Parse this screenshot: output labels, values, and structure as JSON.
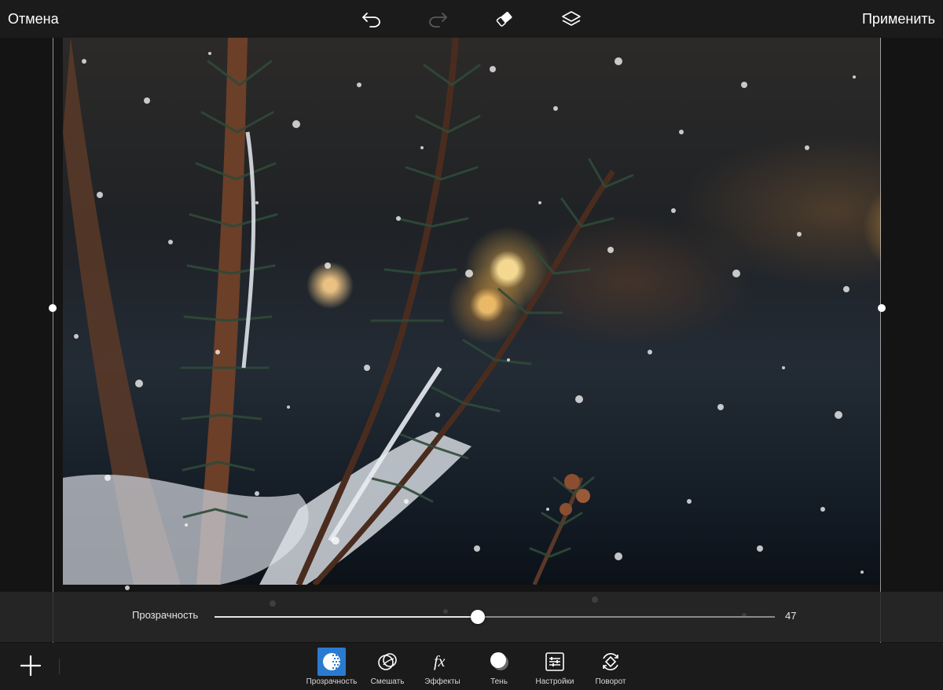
{
  "topbar": {
    "cancel_label": "Отмена",
    "apply_label": "Применить",
    "icons": [
      "undo-icon",
      "redo-icon",
      "eraser-icon",
      "layers-icon"
    ]
  },
  "opacity": {
    "label": "Прозрачность",
    "value": "47",
    "percent": 47
  },
  "tools": [
    {
      "label": "Прозрачность",
      "icon": "opacity-icon",
      "active": true
    },
    {
      "label": "Смешать",
      "icon": "blend-icon",
      "active": false
    },
    {
      "label": "Эффекты",
      "icon": "fx-icon",
      "active": false
    },
    {
      "label": "Тень",
      "icon": "shadow-icon",
      "active": false
    },
    {
      "label": "Настройки",
      "icon": "settings-icon",
      "active": false
    },
    {
      "label": "Поворот",
      "icon": "rotate-icon",
      "active": false
    }
  ],
  "colors": {
    "accent": "#2a7bd0",
    "background": "#161616"
  }
}
